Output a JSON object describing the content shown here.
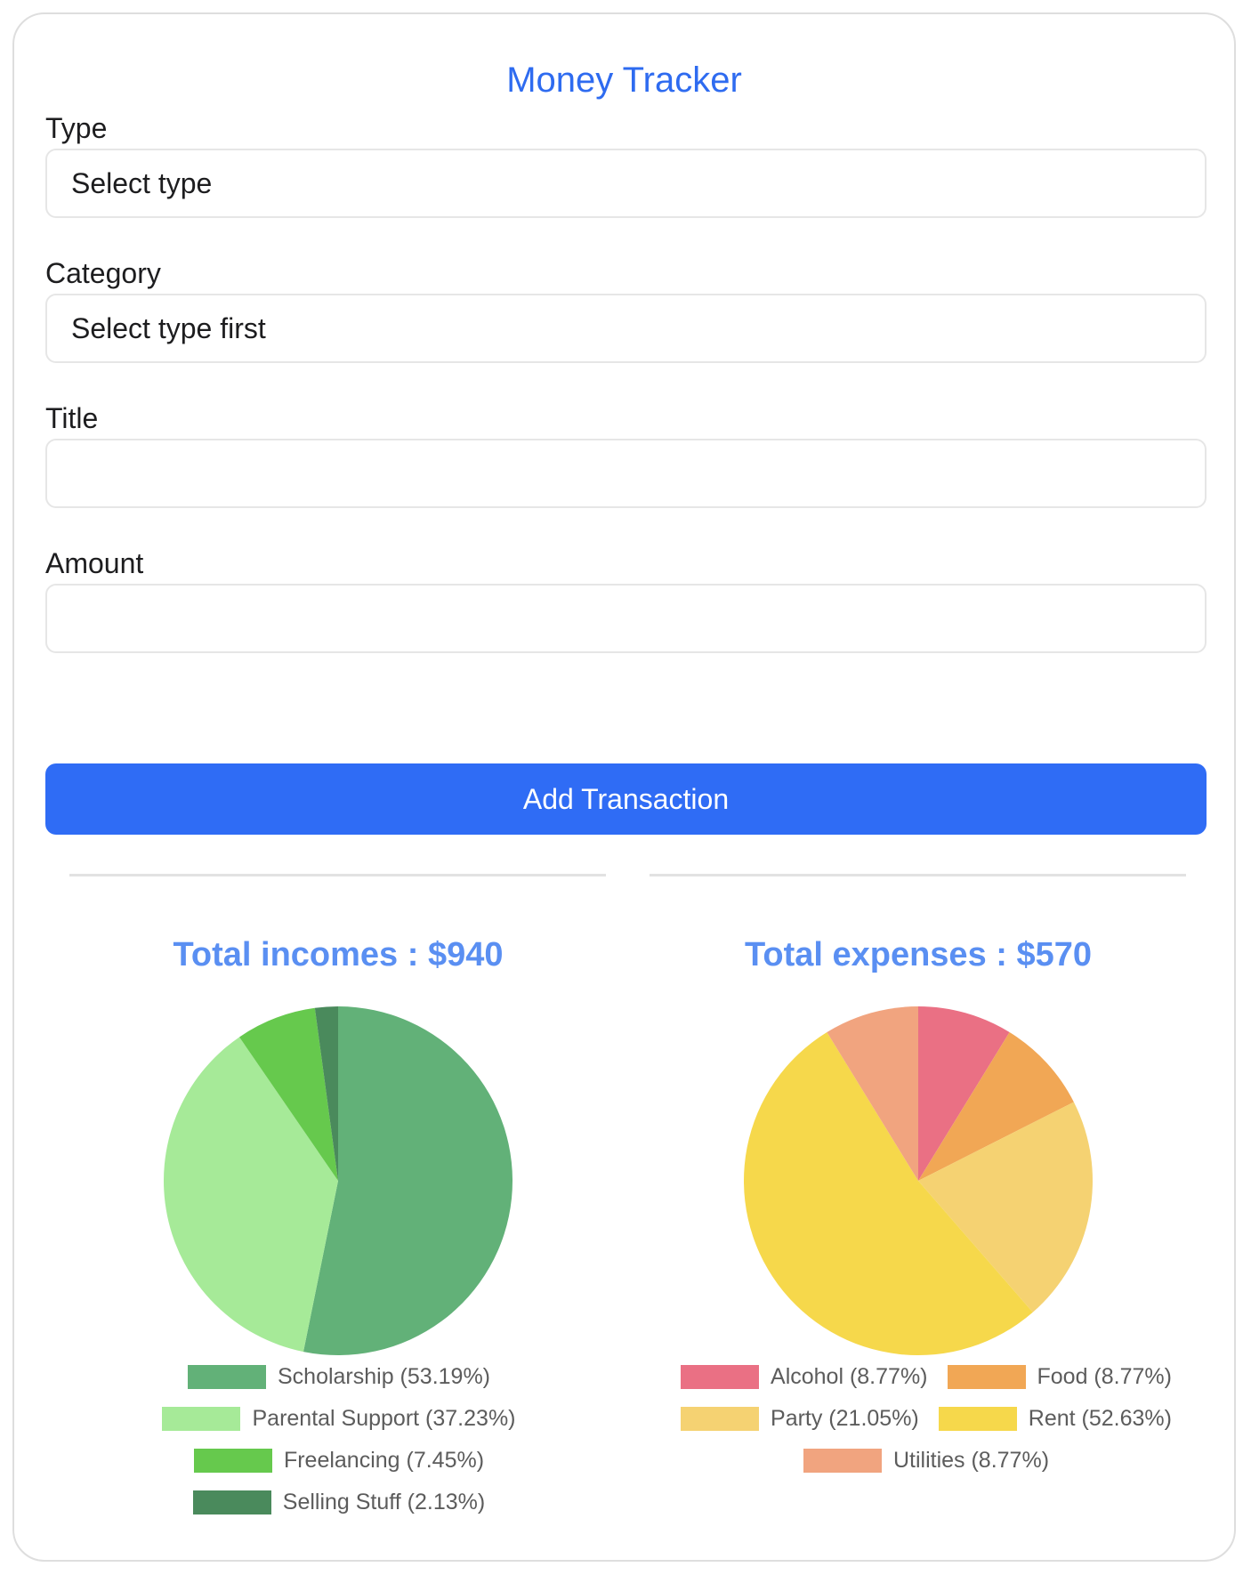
{
  "app": {
    "title": "Money Tracker"
  },
  "form": {
    "type": {
      "label": "Type",
      "value": "Select type"
    },
    "category": {
      "label": "Category",
      "value": "Select type first"
    },
    "title": {
      "label": "Title",
      "value": ""
    },
    "amount": {
      "label": "Amount",
      "value": ""
    },
    "submit_label": "Add Transaction"
  },
  "summary": {
    "incomes_title": "Total incomes : $940",
    "expenses_title": "Total expenses : $570"
  },
  "chart_data": [
    {
      "type": "pie",
      "title": "Total incomes : $940",
      "legend_position": "bottom",
      "labels": [
        "Scholarship (53.19%)",
        "Parental Support (37.23%)",
        "Freelancing (7.45%)",
        "Selling Stuff (2.13%)"
      ],
      "values": [
        53.19,
        37.23,
        7.45,
        2.13
      ],
      "colors": [
        "#62b178",
        "#a6ea98",
        "#66c94d",
        "#4a8a5c"
      ]
    },
    {
      "type": "pie",
      "title": "Total expenses : $570",
      "legend_position": "bottom",
      "labels": [
        "Alcohol (8.77%)",
        "Food (8.77%)",
        "Party (21.05%)",
        "Rent (52.63%)",
        "Utilities (8.77%)"
      ],
      "values": [
        8.77,
        8.77,
        21.05,
        52.63,
        8.77
      ],
      "colors": [
        "#ea7084",
        "#f1a755",
        "#f5d272",
        "#f6d84b",
        "#f1a47f"
      ]
    }
  ]
}
